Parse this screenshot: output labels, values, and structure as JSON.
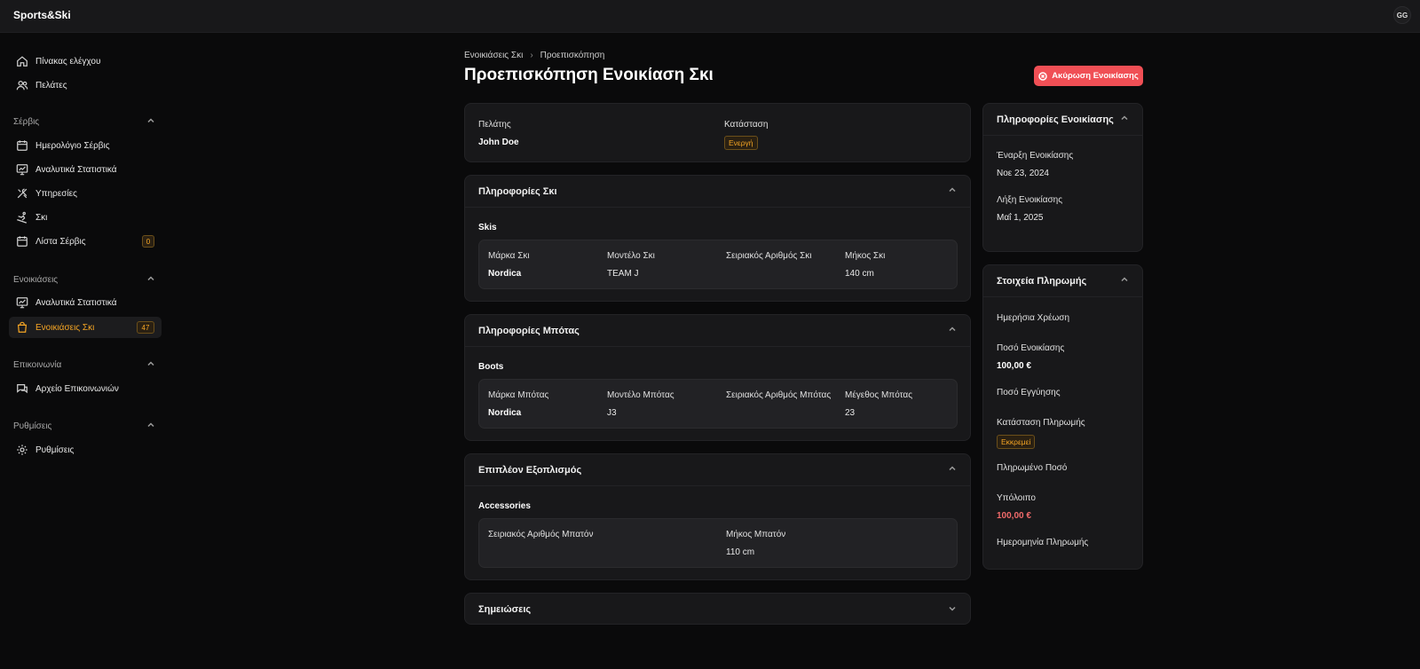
{
  "app": {
    "brand": "Sports&Ski",
    "avatar_initials": "GG"
  },
  "sidebar": {
    "items_top": [
      {
        "label": "Πίνακας ελέγχου",
        "icon": "home-icon"
      },
      {
        "label": "Πελάτες",
        "icon": "users-icon"
      }
    ],
    "sections": [
      {
        "label": "Σέρβις",
        "items": [
          {
            "label": "Ημερολόγιο Σέρβις",
            "icon": "calendar-icon"
          },
          {
            "label": "Αναλυτικά Στατιστικά",
            "icon": "chart-monitor-icon"
          },
          {
            "label": "Υπηρεσίες",
            "icon": "tools-icon"
          },
          {
            "label": "Σκι",
            "icon": "skier-icon"
          },
          {
            "label": "Λίστα Σέρβις",
            "icon": "calendar-icon",
            "badge": "0"
          }
        ]
      },
      {
        "label": "Ενοικιάσεις",
        "items": [
          {
            "label": "Αναλυτικά Στατιστικά",
            "icon": "chart-monitor-icon"
          },
          {
            "label": "Ενοικιάσεις Σκι",
            "icon": "shopping-bag-icon",
            "badge": "47",
            "active": true
          }
        ]
      },
      {
        "label": "Επικοινωνία",
        "items": [
          {
            "label": "Αρχείο Επικοινωνιών",
            "icon": "chat-icon"
          }
        ]
      },
      {
        "label": "Ρυθμίσεις",
        "items": [
          {
            "label": "Ρυθμίσεις",
            "icon": "gear-icon"
          }
        ]
      }
    ]
  },
  "breadcrumb": {
    "parent": "Ενοικιάσεις Σκι",
    "current": "Προεπισκόπηση"
  },
  "page": {
    "title": "Προεπισκόπηση Ενοικίαση Σκι",
    "cancel_label": "Ακύρωση Ενοικίασης"
  },
  "summary": {
    "customer_label": "Πελάτης",
    "customer_value": "John Doe",
    "status_label": "Κατάσταση",
    "status_value": "Ενεργή"
  },
  "ski_info": {
    "title": "Πληροφορίες Σκι",
    "group": "Skis",
    "columns": [
      "Μάρκα Σκι",
      "Μοντέλο Σκι",
      "Σειριακός Αριθμός Σκι",
      "Μήκος Σκι"
    ],
    "values": [
      "Nordica",
      "TEAM J",
      "",
      "140 cm"
    ]
  },
  "boot_info": {
    "title": "Πληροφορίες Μπότας",
    "group": "Boots",
    "columns": [
      "Μάρκα Μπότας",
      "Μοντέλο Μπότας",
      "Σειριακός Αριθμός Μπότας",
      "Μέγεθος Μπότας"
    ],
    "values": [
      "Nordica",
      "J3",
      "",
      "23"
    ]
  },
  "extra_equipment": {
    "title": "Επιπλέον Εξοπλισμός",
    "group": "Accessories",
    "columns": [
      "Σειριακός Αριθμός Μπατόν",
      "Μήκος Μπατόν"
    ],
    "values": [
      "",
      "110 cm"
    ]
  },
  "notes": {
    "title": "Σημειώσεις"
  },
  "rental_info": {
    "title": "Πληροφορίες Ενοικίασης",
    "start_label": "Έναρξη Ενοικίασης",
    "start_value": "Νοε 23, 2024",
    "end_label": "Λήξη Ενοικίασης",
    "end_value": "Μαΐ 1, 2025"
  },
  "payment": {
    "title": "Στοιχεία Πληρωμής",
    "daily_label": "Ημερήσια Χρέωση",
    "amount_label": "Ποσό Ενοικίασης",
    "amount_value": "100,00 €",
    "deposit_label": "Ποσό Εγγύησης",
    "status_label": "Κατάσταση Πληρωμής",
    "status_value": "Εκκρεμεί",
    "paid_label": "Πληρωμένο Ποσό",
    "balance_label": "Υπόλοιπο",
    "balance_value": "100,00 €",
    "date_label": "Ημερομηνία Πληρωμής"
  },
  "colors": {
    "accent": "#f5a524",
    "danger": "#f04f55",
    "background": "#0a0a0b",
    "card": "#18181a"
  }
}
